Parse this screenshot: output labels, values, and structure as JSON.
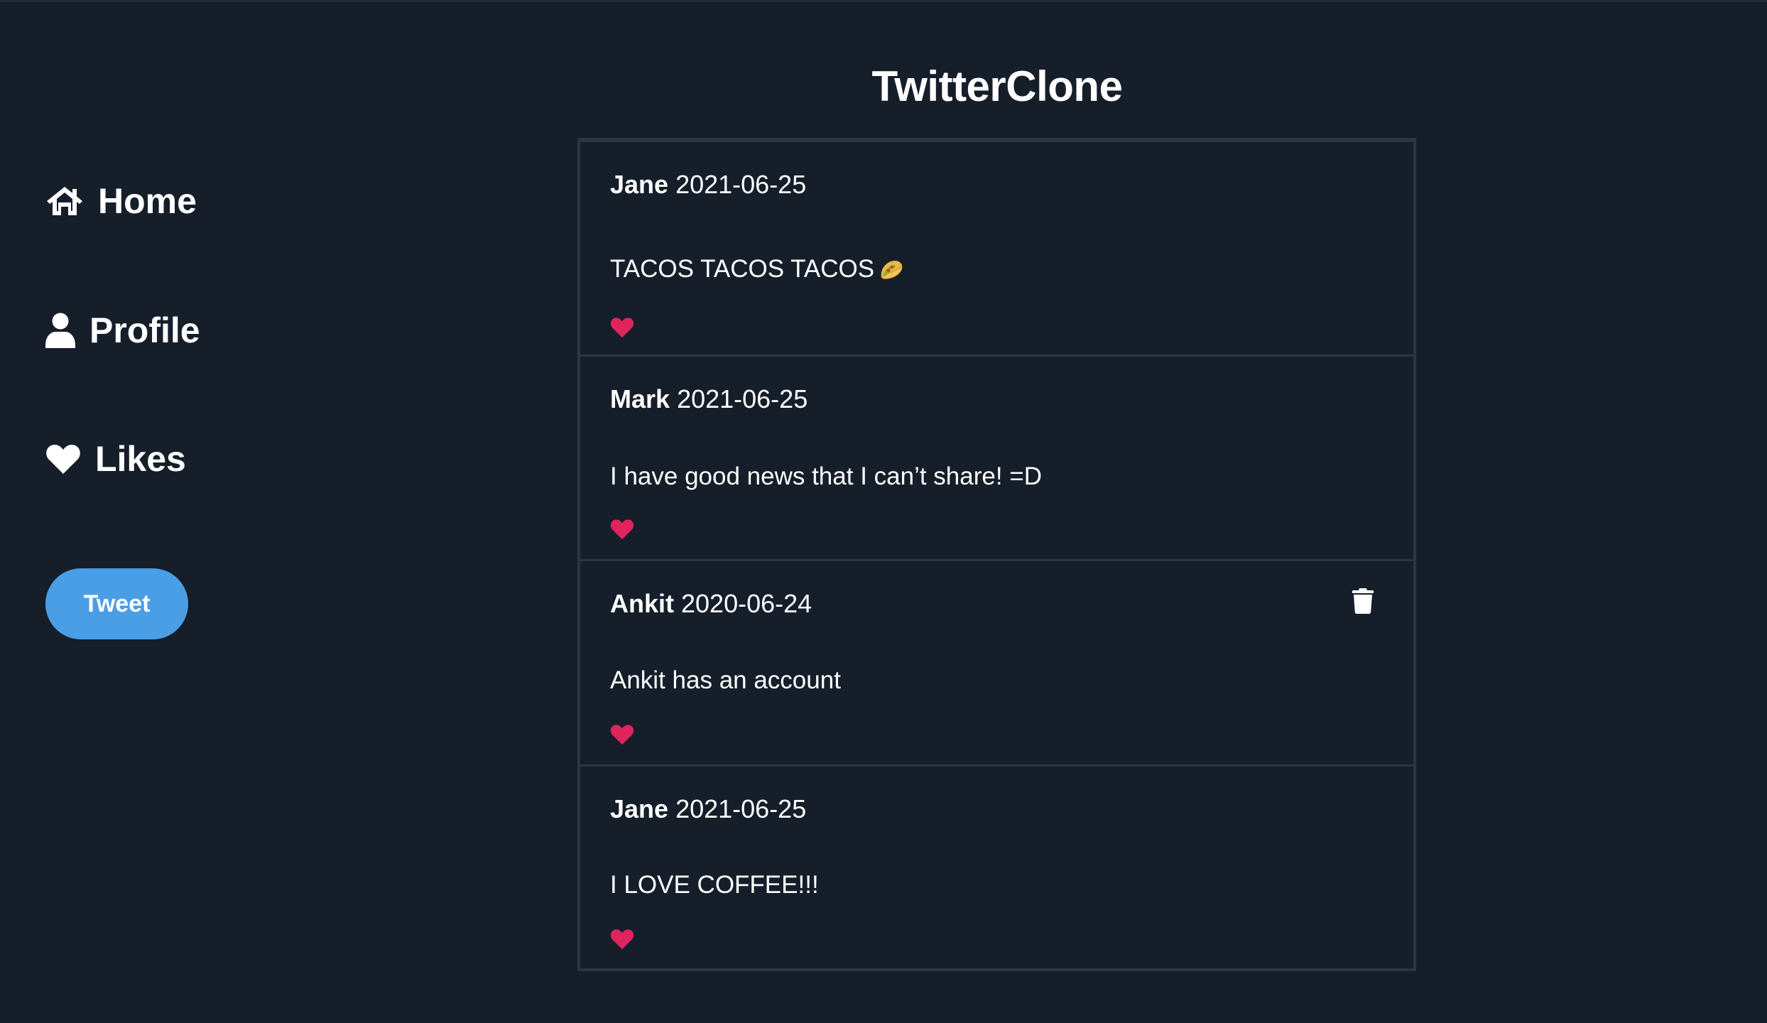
{
  "app": {
    "title": "TwitterClone"
  },
  "sidebar": {
    "items": [
      {
        "label": "Home",
        "icon": "home-icon"
      },
      {
        "label": "Profile",
        "icon": "user-icon"
      },
      {
        "label": "Likes",
        "icon": "heart-icon"
      }
    ],
    "tweet_button_label": "Tweet"
  },
  "feed": {
    "tweets": [
      {
        "author": "Jane",
        "date": "2021-06-25",
        "text": "TACOS TACOS TACOS",
        "emoji": "taco-icon",
        "liked": true,
        "deletable": false
      },
      {
        "author": "Mark",
        "date": "2021-06-25",
        "text": "I have good news that I can’t share! =D",
        "liked": true,
        "deletable": false
      },
      {
        "author": "Ankit",
        "date": "2020-06-24",
        "text": "Ankit has an account",
        "liked": true,
        "deletable": true
      },
      {
        "author": "Jane",
        "date": "2021-06-25",
        "text": "I LOVE COFFEE!!!",
        "liked": true,
        "deletable": false
      }
    ]
  },
  "colors": {
    "background": "#161e2a",
    "accent": "#4a9ee6",
    "like": "#e0245e",
    "border": "#2b3643"
  }
}
